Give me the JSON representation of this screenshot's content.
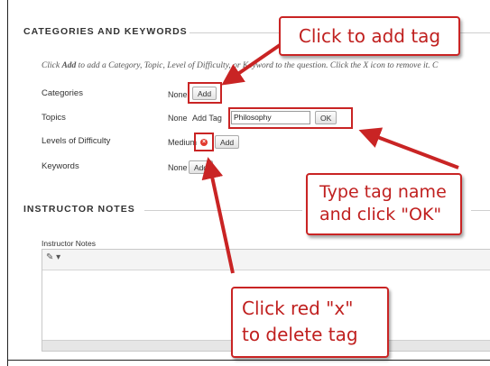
{
  "sections": {
    "categories_title": "CATEGORIES AND KEYWORDS",
    "notes_title": "INSTRUCTOR NOTES"
  },
  "instructions": {
    "pre": "Click ",
    "add": "Add",
    "post": " to add a Category, Topic, Level of Difficulty, or Keyword to the question. Click the X icon to remove it. C"
  },
  "rows": {
    "categories": {
      "label": "Categories",
      "value": "None",
      "add_label": "Add"
    },
    "topics": {
      "label": "Topics",
      "value": "None",
      "add_tag_label": "Add Tag",
      "input_value": "Philosophy",
      "ok_label": "OK"
    },
    "difficulty": {
      "label": "Levels of Difficulty",
      "value": "Medium",
      "delete_glyph": "×",
      "add_label": "Add"
    },
    "keywords": {
      "label": "Keywords",
      "value": "None",
      "add_label": "Add"
    }
  },
  "notes": {
    "label": "Instructor Notes",
    "toolbar_glyph": "✎ ▾"
  },
  "callouts": {
    "add_tag": "Click to add tag",
    "type_tag_line1": "Type tag name",
    "type_tag_line2": "and click \"OK\"",
    "delete_line1": "Click red \"x\"",
    "delete_line2": "to delete tag"
  },
  "colors": {
    "accent_red": "#c92424",
    "delete_icon": "#e23a2e"
  },
  "icons": [
    "delete-x-icon",
    "spellcheck-icon",
    "arrow-icon"
  ]
}
